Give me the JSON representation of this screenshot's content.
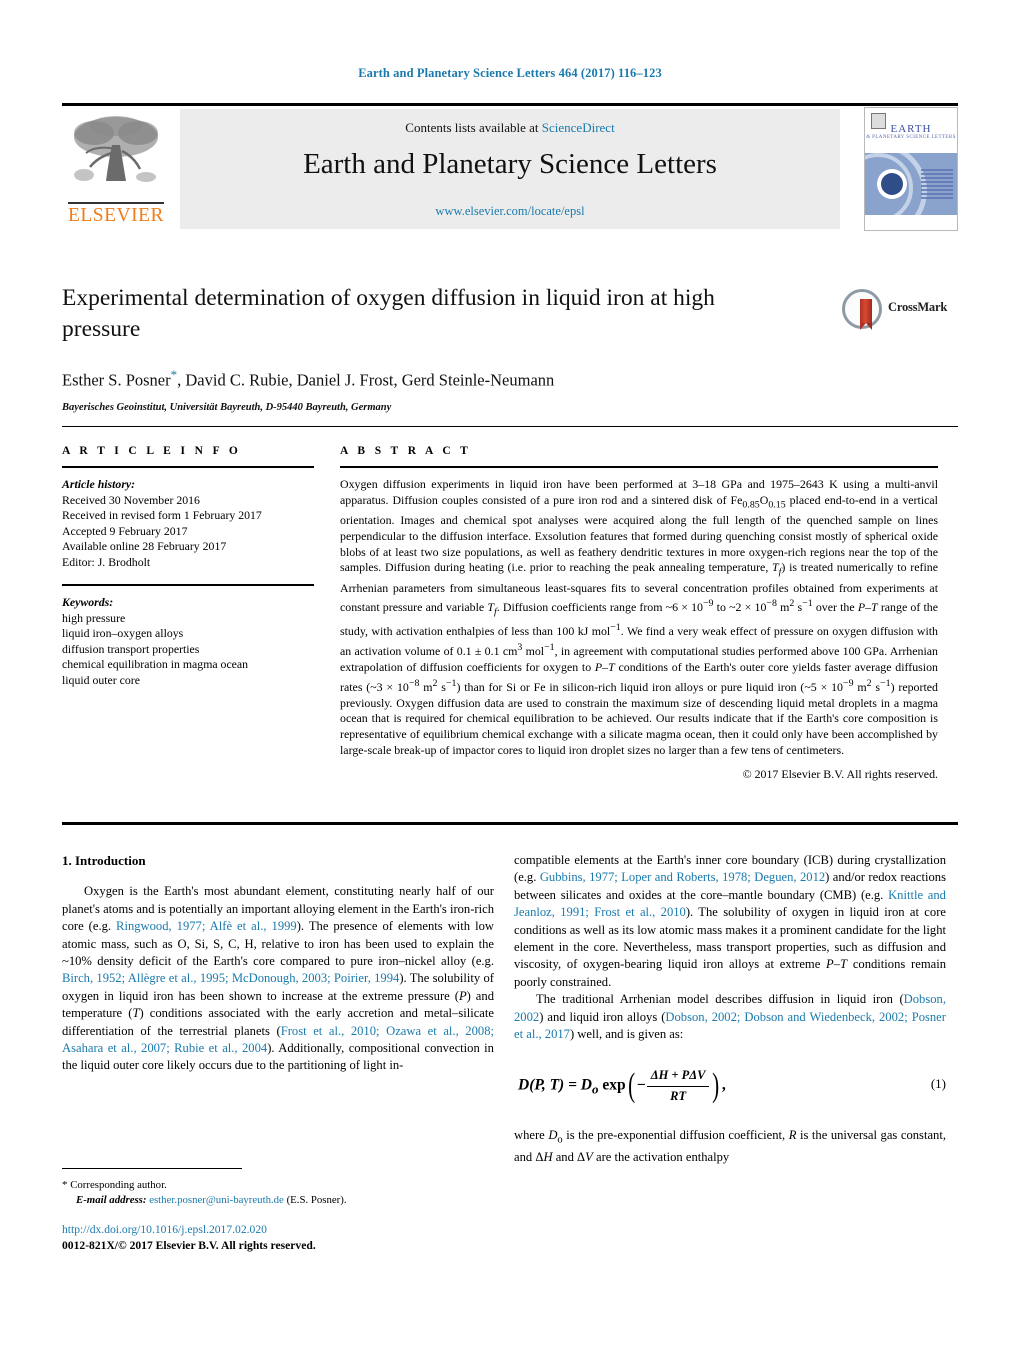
{
  "running_head": "Earth and Planetary Science Letters 464 (2017) 116–123",
  "masthead": {
    "publisher": "ELSEVIER",
    "contents_prefix": "Contents lists available at ",
    "sciencedirect": "ScienceDirect",
    "journal_title": "Earth and Planetary Science Letters",
    "journal_url": "www.elsevier.com/locate/epsl",
    "cover": {
      "title_line1": "EARTH",
      "title_line2": "& PLANETARY SCIENCE LETTERS"
    }
  },
  "article": {
    "title": "Experimental determination of oxygen diffusion in liquid iron at high pressure",
    "authors": "Esther S. Posner",
    "authors_rest": ", David C. Rubie, Daniel J. Frost, Gerd Steinle-Neumann",
    "corresponding_marker": "*",
    "affiliation": "Bayerisches Geoinstitut, Universität Bayreuth, D-95440 Bayreuth, Germany",
    "crossmark_label": "CrossMark"
  },
  "info": {
    "heading": "A R T I C L E   I N F O",
    "history_heading": "Article history:",
    "history": [
      "Received 30 November 2016",
      "Received in revised form 1 February 2017",
      "Accepted 9 February 2017",
      "Available online 28 February 2017",
      "Editor: J. Brodholt"
    ],
    "keywords_heading": "Keywords:",
    "keywords": [
      "high pressure",
      "liquid iron–oxygen alloys",
      "diffusion transport properties",
      "chemical equilibration in magma ocean",
      "liquid outer core"
    ]
  },
  "abstract": {
    "heading": "A B S T R A C T",
    "text": "Oxygen diffusion experiments in liquid iron have been performed at 3–18 GPa and 1975–2643 K using a multi-anvil apparatus. Diffusion couples consisted of a pure iron rod and a sintered disk of Fe0.85O0.15 placed end-to-end in a vertical orientation. Images and chemical spot analyses were acquired along the full length of the quenched sample on lines perpendicular to the diffusion interface. Exsolution features that formed during quenching consist mostly of spherical oxide blobs of at least two size populations, as well as feathery dendritic textures in more oxygen-rich regions near the top of the samples. Diffusion during heating (i.e. prior to reaching the peak annealing temperature, Tf) is treated numerically to refine Arrhenian parameters from simultaneous least-squares fits to several concentration profiles obtained from experiments at constant pressure and variable Tf. Diffusion coefficients range from ~6 × 10−9 to ~2 × 10−8 m2 s−1 over the P–T range of the study, with activation enthalpies of less than 100 kJ mol−1. We find a very weak effect of pressure on oxygen diffusion with an activation volume of 0.1 ± 0.1 cm3 mol−1, in agreement with computational studies performed above 100 GPa. Arrhenian extrapolation of diffusion coefficients for oxygen to P–T conditions of the Earth's outer core yields faster average diffusion rates (~3 × 10−8 m2 s−1) than for Si or Fe in silicon-rich liquid iron alloys or pure liquid iron (~5 × 10−9 m2 s−1) reported previously. Oxygen diffusion data are used to constrain the maximum size of descending liquid metal droplets in a magma ocean that is required for chemical equilibration to be achieved. Our results indicate that if the Earth's core composition is representative of equilibrium chemical exchange with a silicate magma ocean, then it could only have been accomplished by large-scale break-up of impactor cores to liquid iron droplet sizes no larger than a few tens of centimeters.",
    "copyright": "© 2017 Elsevier B.V. All rights reserved."
  },
  "body": {
    "section_heading": "1. Introduction",
    "left_paragraph": "Oxygen is the Earth's most abundant element, constituting nearly half of our planet's atoms and is potentially an important alloying element in the Earth's iron-rich core (e.g. Ringwood, 1977; Alfè et al., 1999). The presence of elements with low atomic mass, such as O, Si, S, C, H, relative to iron has been used to explain the ~10% density deficit of the Earth's core compared to pure iron–nickel alloy (e.g. Birch, 1952; Allègre et al., 1995; McDonough, 2003; Poirier, 1994). The solubility of oxygen in liquid iron has been shown to increase at the extreme pressure (P) and temperature (T) conditions associated with the early accretion and metal–silicate differentiation of the terrestrial planets (Frost et al., 2010; Ozawa et al., 2008; Asahara et al., 2007; Rubie et al., 2004). Additionally, compositional convection in the liquid outer core likely occurs due to the partitioning of light in-",
    "right_paragraph_1": "compatible elements at the Earth's inner core boundary (ICB) during crystallization (e.g. Gubbins, 1977; Loper and Roberts, 1978; Deguen, 2012) and/or redox reactions between silicates and oxides at the core–mantle boundary (CMB) (e.g. Knittle and Jeanloz, 1991; Frost et al., 2010). The solubility of oxygen in liquid iron at core conditions as well as its low atomic mass makes it a prominent candidate for the light element in the core. Nevertheless, mass transport properties, such as diffusion and viscosity, of oxygen-bearing liquid iron alloys at extreme P–T conditions remain poorly constrained.",
    "right_paragraph_2": "The traditional Arrhenian model describes diffusion in liquid iron (Dobson, 2002) and liquid iron alloys (Dobson, 2002; Dobson and Wiedenbeck, 2002; Posner et al., 2017) well, and is given as:",
    "equation": {
      "lhs": "D(P, T) = D",
      "lhs_sub": "o",
      "exp": "exp",
      "numerator": "ΔH + PΔV",
      "denominator": "RT",
      "number": "(1)"
    },
    "right_paragraph_3": "where Do is the pre-exponential diffusion coefficient, R is the universal gas constant, and ΔH and ΔV are the activation enthalpy"
  },
  "footer": {
    "corresponding_star": "*",
    "corresponding_text": "Corresponding author.",
    "email_label": "E-mail address:",
    "email": "esther.posner@uni-bayreuth.de",
    "email_suffix": "(E.S. Posner).",
    "doi": "http://dx.doi.org/10.1016/j.epsl.2017.02.020",
    "issn_line": "0012-821X/© 2017 Elsevier B.V. All rights reserved."
  },
  "colors": {
    "link_blue": "#1a7aad",
    "elsevier_orange": "#f07d1a",
    "band_gray": "#ececec"
  }
}
